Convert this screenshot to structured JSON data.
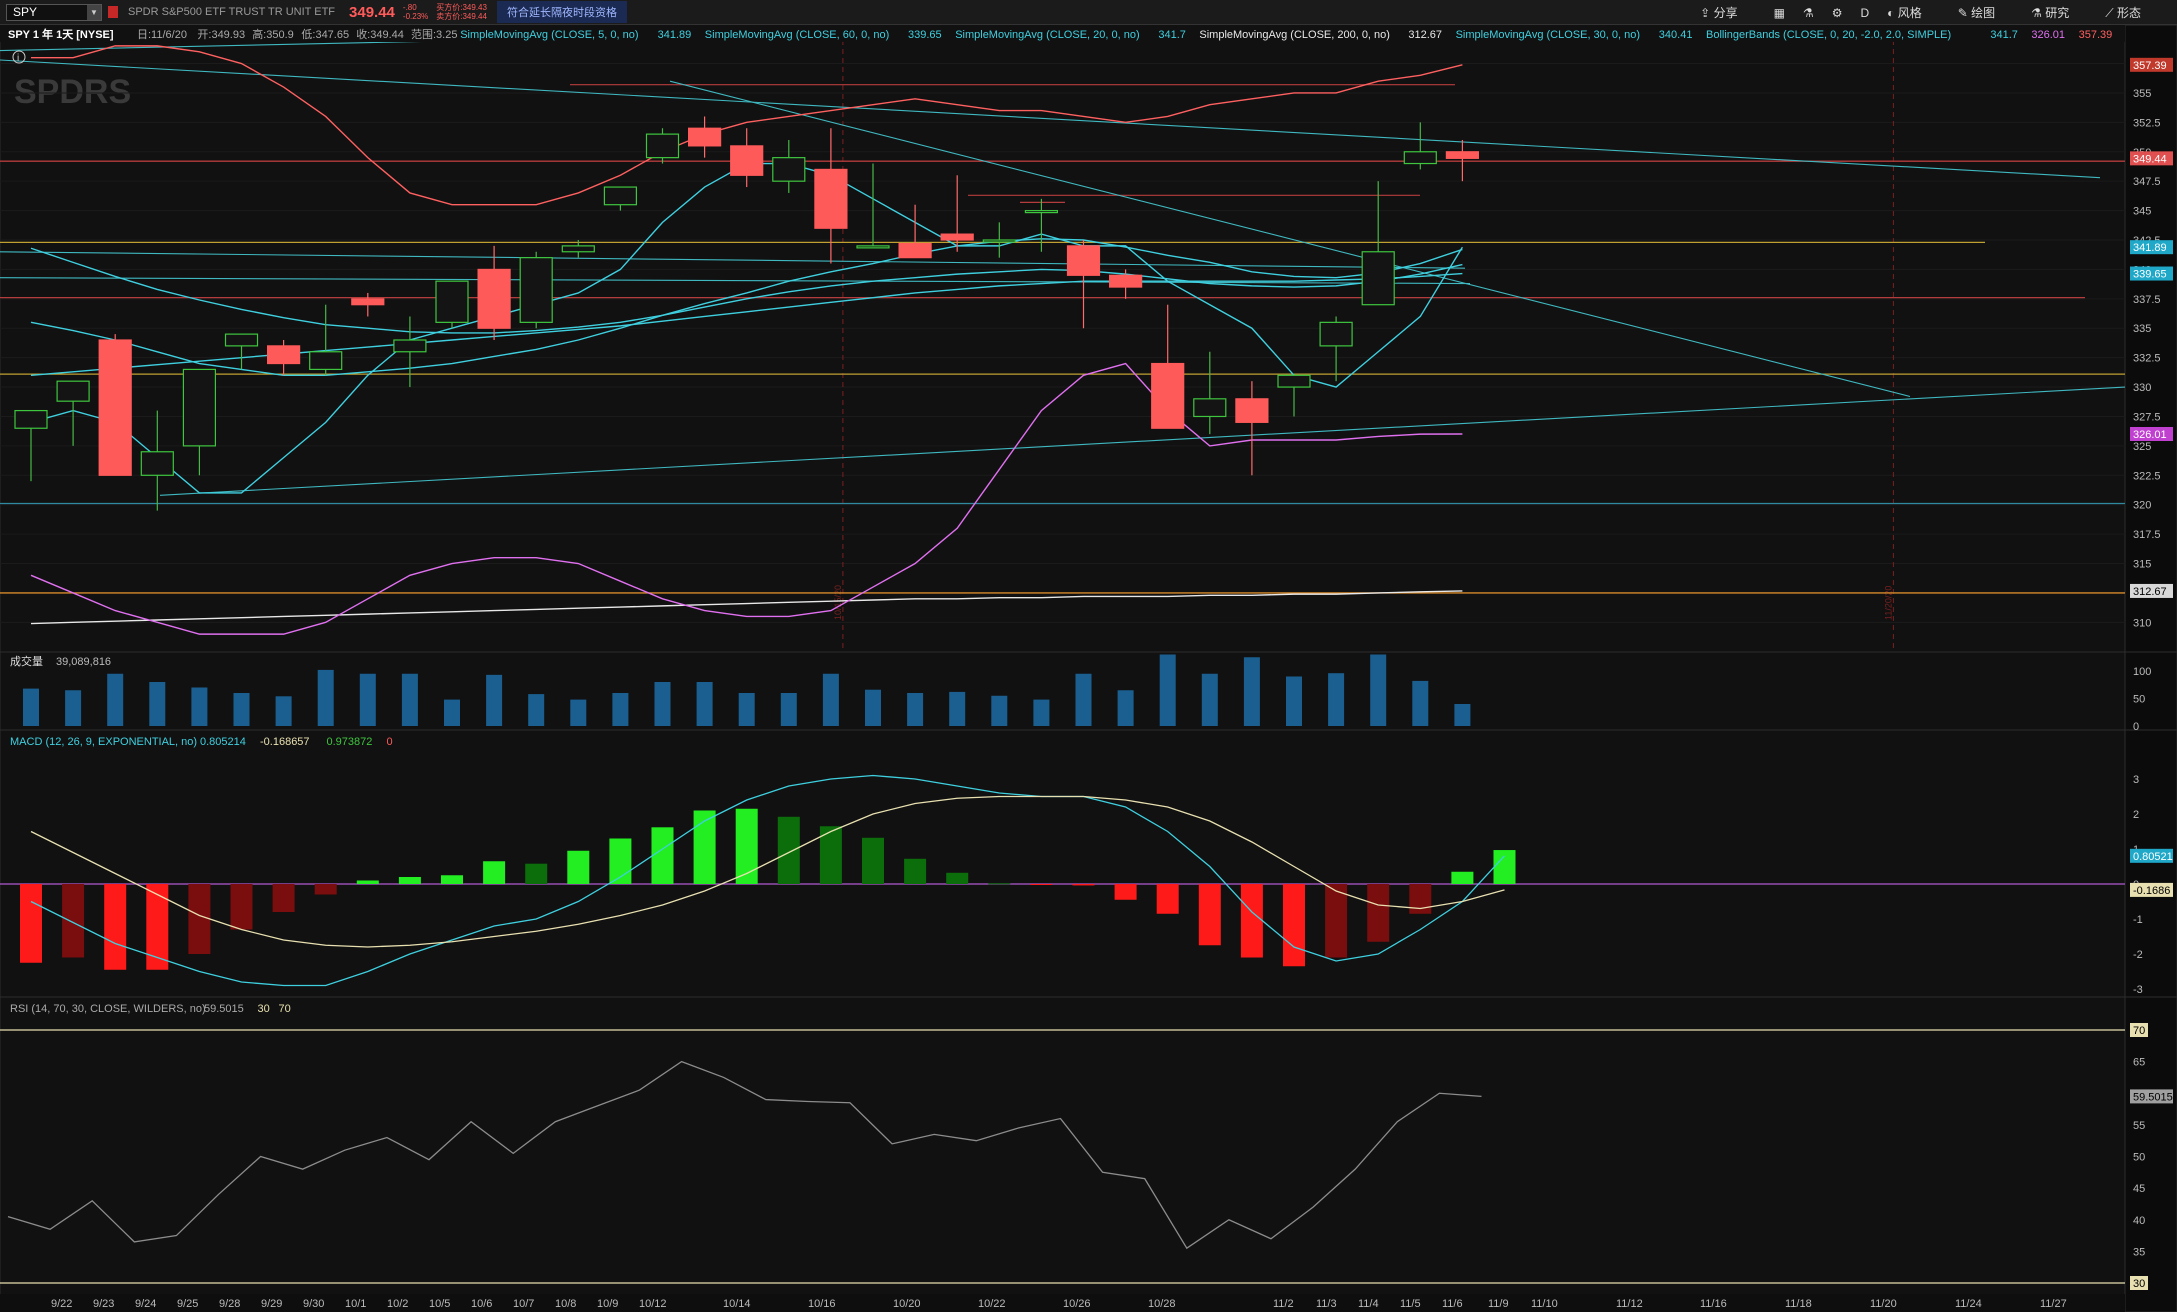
{
  "toolbar": {
    "symbol": "SPY",
    "description": "SPDR S&P500 ETF TRUST TR UNIT ETF",
    "last_price": "349.44",
    "net_change": "-.80",
    "pct_change": "-0.23%",
    "bid": "买方价:349.43",
    "ask": "卖方价:349.44",
    "extended_hours": "符合延长隔夜时段资格",
    "share_label": "分享",
    "period_label": "D",
    "style_label": "风格",
    "drawing_label": "绘图",
    "study_label": "研究",
    "pattern_label": "形态"
  },
  "price_panel": {
    "title": "SPY 1 年 1天 [NYSE]",
    "date": "日:11/6/20",
    "open": "开:349.93",
    "high": "高:350.9",
    "low": "低:347.65",
    "close": "收:349.44",
    "range": "范围:3.25",
    "legend": [
      {
        "label": "SimpleMovingAvg (CLOSE, 5, 0, no)",
        "value": "341.89",
        "color": "#3fd0e0"
      },
      {
        "label": "SimpleMovingAvg (CLOSE, 60, 0, no)",
        "value": "339.65",
        "color": "#3fd0e0"
      },
      {
        "label": "SimpleMovingAvg (CLOSE, 20, 0, no)",
        "value": "341.7",
        "color": "#3fd0e0"
      },
      {
        "label": "SimpleMovingAvg (CLOSE, 200, 0, no)",
        "value": "312.67",
        "color": "#e8e8e8"
      },
      {
        "label": "SimpleMovingAvg (CLOSE, 30, 0, no)",
        "value": "340.41",
        "color": "#3fd0e0"
      },
      {
        "label": "BollingerBands (CLOSE, 0, 20, -2.0, 2.0, SIMPLE)",
        "value": "341.7",
        "color": "#3fd0e0"
      },
      {
        "label": "",
        "value": "326.01",
        "color": "#e070f0"
      },
      {
        "label": "",
        "value": "357.39",
        "color": "#ff6060"
      }
    ],
    "watermark": "SPDRS",
    "axis_ticks": [
      "357.5",
      "355",
      "352.5",
      "350",
      "347.5",
      "345",
      "342.5",
      "340",
      "337.5",
      "335",
      "332.5",
      "330",
      "327.5",
      "325",
      "322.5",
      "320",
      "317.5",
      "315",
      "312.5",
      "310"
    ],
    "price_tags": [
      {
        "value": "357.39",
        "bg": "#c0392b",
        "fg": "#ffffff"
      },
      {
        "value": "349.44",
        "bg": "#e05050",
        "fg": "#ffffff"
      },
      {
        "value": "341.89",
        "bg": "#1fa8c8",
        "fg": "#ffffff"
      },
      {
        "value": "339.65",
        "bg": "#1fa8c8",
        "fg": "#ffffff"
      },
      {
        "value": "326.01",
        "bg": "#c040d0",
        "fg": "#ffffff"
      },
      {
        "value": "312.67",
        "bg": "#d8d8d8",
        "fg": "#000000"
      }
    ],
    "event_markers": [
      "10/15/20",
      "11/20/20"
    ]
  },
  "chart_data": [
    {
      "type": "candlestick",
      "title": "SPY 1 年 1天 [NYSE]",
      "x": [
        "9/21",
        "9/22",
        "9/23",
        "9/24",
        "9/25",
        "9/28",
        "9/29",
        "9/30",
        "10/1",
        "10/2",
        "10/5",
        "10/6",
        "10/7",
        "10/8",
        "10/9",
        "10/12",
        "10/13",
        "10/14",
        "10/15",
        "10/16",
        "10/19",
        "10/20",
        "10/21",
        "10/22",
        "10/23",
        "10/26",
        "10/27",
        "10/28",
        "10/29",
        "10/30",
        "11/2",
        "11/3",
        "11/4",
        "11/5",
        "11/6"
      ],
      "open": [
        326.5,
        328.8,
        334.0,
        322.5,
        325.0,
        333.5,
        333.5,
        331.5,
        337.5,
        333.0,
        335.5,
        340.0,
        335.5,
        341.5,
        345.5,
        349.5,
        352.0,
        350.5,
        347.5,
        348.5,
        342.0,
        342.2,
        343.0,
        342.5,
        345.0,
        342.0,
        339.5,
        332.0,
        327.5,
        329.0,
        330.0,
        333.5,
        337.0,
        349.0,
        350.0
      ],
      "high": [
        327.0,
        330.0,
        334.5,
        328.0,
        330.0,
        334.5,
        334.0,
        337.0,
        338.0,
        336.0,
        339.0,
        342.0,
        341.5,
        342.5,
        347.0,
        352.0,
        353.0,
        352.0,
        351.0,
        352.0,
        349.0,
        345.5,
        348.0,
        344.0,
        346.0,
        342.5,
        340.0,
        337.0,
        333.0,
        330.5,
        331.0,
        336.0,
        347.5,
        352.5,
        351.0
      ],
      "low": [
        322.0,
        325.0,
        322.5,
        319.5,
        322.5,
        331.5,
        331.0,
        331.0,
        336.0,
        330.0,
        335.0,
        334.0,
        335.0,
        341.0,
        345.0,
        349.0,
        349.5,
        347.0,
        346.5,
        340.5,
        342.0,
        341.5,
        341.5,
        341.0,
        341.5,
        335.0,
        337.5,
        327.0,
        326.0,
        322.5,
        327.5,
        330.5,
        337.0,
        348.5,
        347.5
      ],
      "close": [
        328.0,
        330.5,
        322.5,
        324.5,
        331.5,
        334.5,
        332.0,
        333.0,
        337.0,
        334.0,
        339.0,
        335.0,
        341.0,
        342.0,
        347.0,
        351.5,
        350.5,
        348.0,
        349.5,
        343.5,
        342.0,
        341.0,
        342.5,
        342.5,
        345.0,
        339.5,
        338.5,
        326.5,
        329.0,
        327.0,
        331.0,
        335.5,
        341.5,
        350.0,
        349.44
      ]
    },
    {
      "type": "line",
      "title": "Moving averages and Bollinger bands",
      "series": [
        {
          "name": "SMA 5",
          "color": "#3fd0e0",
          "values": [
            327,
            328,
            327,
            324,
            321,
            321,
            324,
            327,
            331,
            334,
            335,
            336,
            337,
            338,
            340,
            344,
            347,
            349,
            349,
            348,
            346,
            344,
            342,
            342,
            343,
            342,
            342,
            339,
            337,
            335,
            331,
            330,
            333,
            336,
            341.89
          ]
        },
        {
          "name": "SMA 20",
          "color": "#3fd0e0",
          "values": [
            335.5,
            334.8,
            334,
            333,
            332,
            331.5,
            331,
            331,
            331.3,
            331.6,
            332,
            332.6,
            333.2,
            334,
            335,
            336.1,
            337.1,
            338,
            339,
            339.8,
            340.5,
            341.3,
            342,
            342.4,
            342.6,
            342.5,
            341.9,
            341.2,
            340.6,
            339.8,
            339.4,
            339.3,
            339.7,
            340.5,
            341.7
          ]
        },
        {
          "name": "SMA 30",
          "color": "#3fd0e0",
          "values": [
            341.8,
            340.6,
            339.4,
            338.3,
            337.4,
            336.6,
            335.9,
            335.3,
            335,
            334.7,
            334.6,
            334.6,
            334.8,
            335.1,
            335.5,
            336.1,
            336.8,
            337.5,
            338.1,
            338.6,
            339,
            339.3,
            339.6,
            339.8,
            340,
            339.9,
            339.6,
            339.2,
            338.8,
            338.6,
            338.5,
            338.6,
            339,
            339.6,
            340.41
          ]
        },
        {
          "name": "SMA 60",
          "color": "#3fd0e0",
          "values": [
            331,
            331.3,
            331.6,
            331.9,
            332.2,
            332.5,
            332.8,
            333.1,
            333.4,
            333.7,
            334,
            334.3,
            334.6,
            334.9,
            335.2,
            335.6,
            336,
            336.4,
            336.8,
            337.2,
            337.6,
            338,
            338.3,
            338.6,
            338.8,
            339,
            339,
            339,
            339,
            339,
            339,
            339.1,
            339.2,
            339.4,
            339.65
          ]
        },
        {
          "name": "SMA 200",
          "color": "#e8e8e8",
          "values": [
            309.9,
            310,
            310.1,
            310.2,
            310.3,
            310.4,
            310.5,
            310.6,
            310.7,
            310.8,
            310.9,
            311,
            311.1,
            311.2,
            311.3,
            311.4,
            311.5,
            311.6,
            311.7,
            311.8,
            311.9,
            312,
            312,
            312.1,
            312.1,
            312.2,
            312.2,
            312.2,
            312.3,
            312.3,
            312.4,
            312.4,
            312.5,
            312.6,
            312.67
          ]
        },
        {
          "name": "BB upper",
          "color": "#ff6060",
          "values": [
            358,
            358,
            359,
            359,
            358.5,
            357.5,
            355.5,
            353,
            349.5,
            346.5,
            345.5,
            345.5,
            345.5,
            346.5,
            348,
            350,
            351.5,
            352.5,
            353,
            353.5,
            354,
            354.5,
            354,
            353.5,
            353.5,
            353,
            352.5,
            353,
            354,
            354.5,
            355,
            355,
            356,
            356.5,
            357.39
          ]
        },
        {
          "name": "BB lower",
          "color": "#e070f0",
          "values": [
            314,
            312.5,
            311,
            310,
            309,
            309,
            309,
            310,
            312,
            314,
            315,
            315.5,
            315.5,
            315,
            313.5,
            312,
            311,
            310.5,
            310.5,
            311,
            313,
            315,
            318,
            323,
            328,
            331,
            332,
            328,
            325,
            325.5,
            325.5,
            325.5,
            325.8,
            326,
            326.01
          ]
        }
      ]
    },
    {
      "type": "bar",
      "title": "成交量",
      "ylabel": "",
      "values": [
        68,
        65,
        95,
        80,
        70,
        60,
        54,
        102,
        95,
        95,
        48,
        93,
        58,
        48,
        60,
        80,
        80,
        60,
        60,
        95,
        66,
        60,
        62,
        55,
        48,
        95,
        65,
        130,
        95,
        125,
        90,
        96,
        130,
        82,
        40
      ],
      "axis_ticks": [
        "100",
        "50",
        "0"
      ],
      "current": "39,089,816"
    },
    {
      "type": "bar",
      "title": "MACD (12, 26, 9, EXPONENTIAL, no)",
      "series": [
        {
          "name": "Diff",
          "values": [
            -2.25,
            -2.1,
            -2.45,
            -2.45,
            -2.0,
            -1.3,
            -0.8,
            -0.3,
            0.1,
            0.2,
            0.25,
            0.65,
            0.58,
            0.95,
            1.3,
            1.62,
            2.1,
            2.15,
            1.92,
            1.65,
            1.32,
            0.72,
            0.32,
            0.02,
            -0.01,
            -0.04,
            -0.45,
            -0.85,
            -1.75,
            -2.1,
            -2.35,
            -2.1,
            -1.65,
            -0.85,
            0.35,
            0.97
          ]
        },
        {
          "name": "Value",
          "values": [
            -0.5,
            -1.1,
            -1.7,
            -2.1,
            -2.5,
            -2.8,
            -2.9,
            -2.9,
            -2.5,
            -2.0,
            -1.6,
            -1.2,
            -1.0,
            -0.5,
            0.2,
            1.0,
            1.8,
            2.4,
            2.8,
            3.0,
            3.1,
            3.0,
            2.8,
            2.6,
            2.5,
            2.5,
            2.2,
            1.5,
            0.5,
            -0.8,
            -1.8,
            -2.2,
            -2.0,
            -1.3,
            -0.5,
            0.805214
          ]
        },
        {
          "name": "Avg",
          "values": [
            1.5,
            0.9,
            0.3,
            -0.3,
            -0.9,
            -1.3,
            -1.6,
            -1.75,
            -1.8,
            -1.75,
            -1.65,
            -1.5,
            -1.35,
            -1.15,
            -0.9,
            -0.6,
            -0.2,
            0.3,
            0.9,
            1.5,
            2.0,
            2.3,
            2.45,
            2.5,
            2.5,
            2.5,
            2.4,
            2.2,
            1.8,
            1.2,
            0.5,
            -0.2,
            -0.6,
            -0.7,
            -0.5,
            -0.168657
          ]
        }
      ],
      "legend_values": [
        "0.805214",
        "-0.168657",
        "0.973872",
        "0"
      ],
      "axis_ticks": [
        "3",
        "2",
        "1",
        "0",
        "-1",
        "-2",
        "-3"
      ],
      "price_tags": [
        {
          "value": "0.80521",
          "bg": "#1fa8c8",
          "fg": "#ffffff"
        },
        {
          "value": "-0.1686",
          "bg": "#e8e0b0",
          "fg": "#000000"
        }
      ]
    },
    {
      "type": "line",
      "title": "RSI (14, 70, 30, CLOSE, WILDERS, no)",
      "values": [
        40.5,
        38.5,
        43,
        36.5,
        37.5,
        44,
        50,
        48,
        51,
        53,
        49.5,
        55.5,
        50.5,
        55.5,
        58,
        60.5,
        65,
        62.5,
        59,
        58.7,
        58.5,
        52,
        53.5,
        52.5,
        54.5,
        56,
        47.5,
        46.5,
        35.5,
        40,
        37,
        42,
        48,
        55.5,
        60,
        59.5015
      ],
      "legend_values": [
        "59.5015",
        "30",
        "70"
      ],
      "axis_ticks": [
        "70",
        "65",
        "60",
        "55",
        "50",
        "45",
        "40",
        "35",
        "30"
      ],
      "price_tags": [
        {
          "value": "70",
          "bg": "#e8e0b0",
          "fg": "#000000"
        },
        {
          "value": "59.5015",
          "bg": "#a0a0a0",
          "fg": "#000000"
        },
        {
          "value": "30",
          "bg": "#e8e0b0",
          "fg": "#000000"
        }
      ]
    }
  ],
  "x_axis": {
    "labels": [
      "9/22",
      "9/23",
      "9/24",
      "9/25",
      "9/28",
      "9/29",
      "9/30",
      "10/1",
      "10/2",
      "10/5",
      "10/6",
      "10/7",
      "10/8",
      "10/9",
      "10/12",
      "10/14",
      "10/16",
      "10/20",
      "10/22",
      "10/26",
      "10/28",
      "11/2",
      "11/3",
      "11/4",
      "11/5",
      "11/6",
      "11/9",
      "11/10",
      "11/12",
      "11/16",
      "11/18",
      "11/20",
      "11/24",
      "11/27"
    ]
  }
}
